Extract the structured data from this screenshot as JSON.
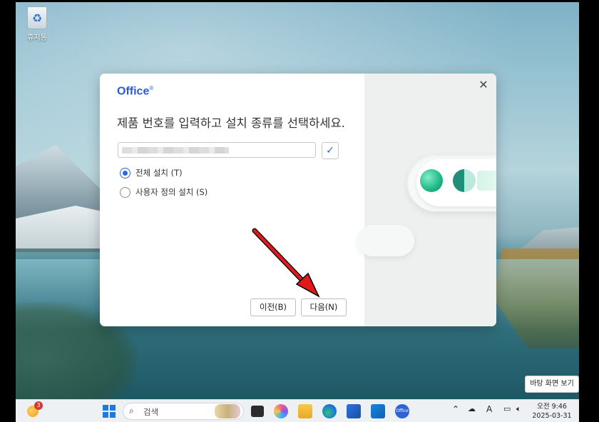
{
  "desktop": {
    "recycle_bin_label": "휴지통",
    "show_desktop_tooltip": "바탕 화면 보기"
  },
  "dialog": {
    "brand": "Office",
    "brand_mark": "®",
    "heading": "제품 번호를 입력하고 설치 종류를 선택하세요.",
    "product_key_value": "",
    "check_icon": "checkmark-icon",
    "options": [
      {
        "label": "전체 설치 (T)",
        "selected": true
      },
      {
        "label": "사용자 정의 설치 (S)",
        "selected": false
      }
    ],
    "back_button": "이전(B)",
    "next_button": "다음(N)",
    "close_icon": "close-icon"
  },
  "annotation": {
    "color": "#e0191c",
    "icon": "red-arrow-icon"
  },
  "taskbar": {
    "weather_badge": "3",
    "search_label": "검색",
    "tray_ime": "A",
    "clock_time": "오전 9:46",
    "clock_date": "2025-03-31",
    "pinned_apps": [
      "task-view",
      "copilot",
      "file-explorer",
      "edge",
      "store",
      "outlook",
      "office"
    ]
  },
  "colors": {
    "accent": "#2a6ad9",
    "brand": "#2a5bd7"
  }
}
